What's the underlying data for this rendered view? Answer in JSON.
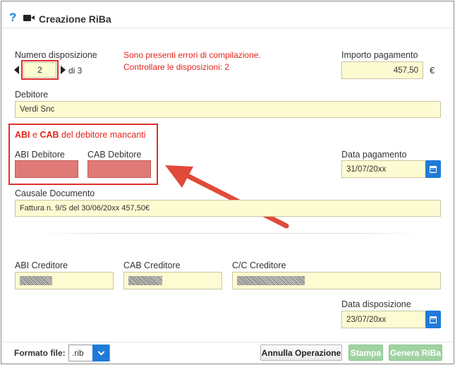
{
  "header": {
    "help_icon_glyph": "?",
    "title": "Creazione RiBa"
  },
  "disposizione": {
    "label": "Numero disposizione",
    "value": "2",
    "of_text": "di 3"
  },
  "errors": {
    "line1": "Sono presenti errori di compilazione.",
    "line2": "Controllare le disposizioni: 2"
  },
  "importo": {
    "label": "Importo pagamento",
    "value": "457,50",
    "currency": "€"
  },
  "debitore": {
    "label": "Debitore",
    "value": "Verdi Snc"
  },
  "abi_cab_warning": {
    "part1": "ABI",
    "part2": " e ",
    "part3": "CAB",
    "part4": " del debitore mancanti"
  },
  "abi_debitore": {
    "label": "ABI Debitore",
    "value": ""
  },
  "cab_debitore": {
    "label": "CAB Debitore",
    "value": ""
  },
  "data_pagamento": {
    "label": "Data pagamento",
    "value": "31/07/20xx"
  },
  "causale": {
    "label": "Causale Documento",
    "value": "Fattura n. 9/S del 30/06/20xx 457,50€"
  },
  "abi_creditore": {
    "label": "ABI Creditore"
  },
  "cab_creditore": {
    "label": "CAB Creditore"
  },
  "cc_creditore": {
    "label": "C/C Creditore"
  },
  "data_disposizione": {
    "label": "Data disposizione",
    "value": "23/07/20xx"
  },
  "footer": {
    "formato_label": "Formato file:",
    "formato_value": ".rib",
    "annulla": "Annulla Operazione",
    "stampa": "Stampa",
    "genera": "Genera RiBa"
  },
  "colors": {
    "error_red": "#e3241c",
    "field_bg": "#fdfbd1",
    "missing_field": "#e07a77",
    "accent_blue": "#1f7ad9",
    "disabled_green": "#9fd3a1"
  },
  "icons": [
    "help-icon",
    "video-icon",
    "caret-left-icon",
    "caret-right-icon",
    "calendar-icon",
    "chevron-down-icon"
  ]
}
